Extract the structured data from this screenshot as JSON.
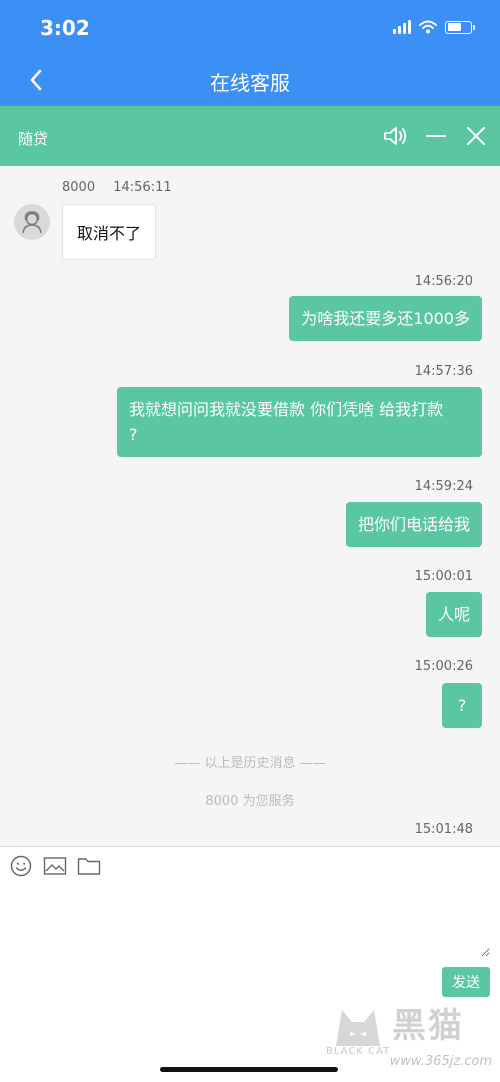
{
  "status_bar": {
    "time": "3:02"
  },
  "nav": {
    "title": "在线客服"
  },
  "sub_header": {
    "title": "随贷"
  },
  "colors": {
    "primary_blue": "#3b8ff5",
    "green": "#5ac6a2"
  },
  "messages": {
    "incoming": {
      "agent_name": "8000",
      "time": "14:56:11",
      "text": "取消不了"
    },
    "outgoing": [
      {
        "time": "14:56:20",
        "text": "为啥我还要多还1000多"
      },
      {
        "time": "14:57:36",
        "text": "我就想问问我就没要借款 你们凭啥 给我打款\n?"
      },
      {
        "time": "14:59:24",
        "text": "把你们电话给我"
      },
      {
        "time": "15:00:01",
        "text": "人呢"
      },
      {
        "time": "15:00:26",
        "text": "?"
      }
    ],
    "history_note": "—— 以上是历史消息 ——",
    "service_note": "8000 为您服务",
    "last_time": "15:01:48"
  },
  "input": {
    "placeholder": "",
    "send_label": "发送"
  },
  "watermark": {
    "brand": "黑猫",
    "sub": "BLACK CAT",
    "url": "www.365jz.com"
  },
  "icons": [
    "signal-icon",
    "wifi-icon",
    "battery-icon",
    "back-icon",
    "speaker-icon",
    "minimize-icon",
    "close-icon",
    "agent-avatar-icon",
    "emoji-icon",
    "image-icon",
    "folder-icon"
  ]
}
